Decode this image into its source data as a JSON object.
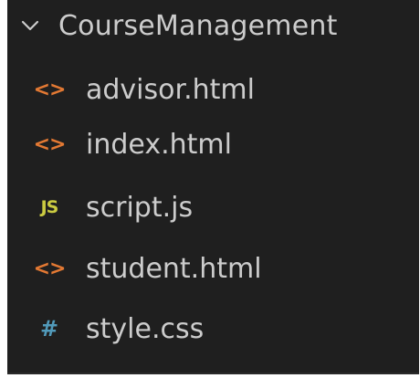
{
  "explorer": {
    "folder": {
      "name": "CourseManagement",
      "icon": "chevron-down-icon"
    },
    "files": [
      {
        "name": "advisor.html",
        "icon": "html-file-icon",
        "glyph": "<>"
      },
      {
        "name": "index.html",
        "icon": "html-file-icon",
        "glyph": "<>"
      },
      {
        "name": "script.js",
        "icon": "js-file-icon",
        "glyph": "JS"
      },
      {
        "name": "student.html",
        "icon": "html-file-icon",
        "glyph": "<>"
      },
      {
        "name": "style.css",
        "icon": "css-file-icon",
        "glyph": "#"
      }
    ]
  },
  "colors": {
    "background": "#1f1f1f",
    "text": "#cccccc",
    "html_icon": "#e37933",
    "js_icon": "#cbcb41",
    "css_icon": "#519aba"
  }
}
